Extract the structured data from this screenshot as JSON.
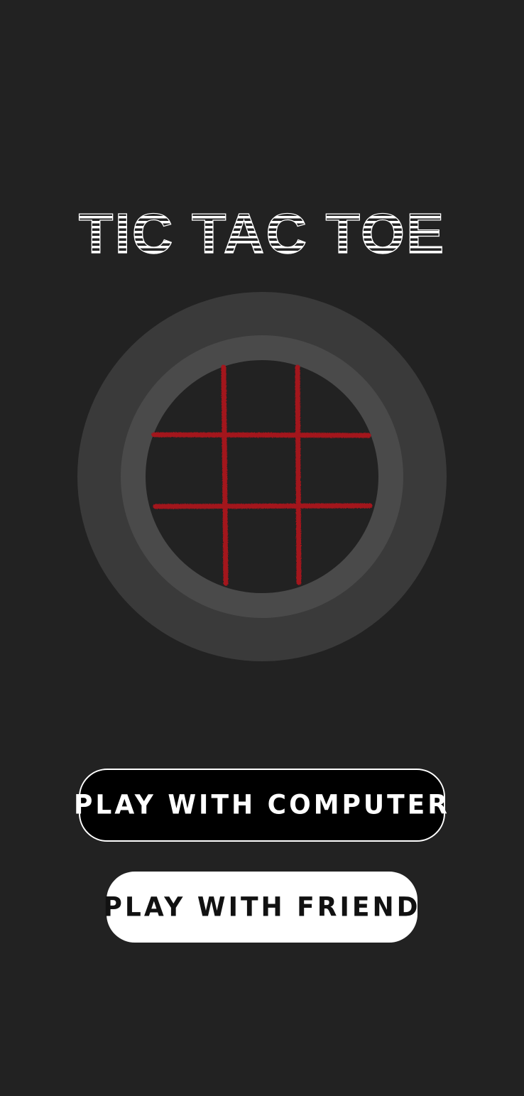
{
  "app": {
    "title": "TIC TAC TOE"
  },
  "menu": {
    "play_computer_label": "PLAY WITH COMPUTER",
    "play_friend_label": "PLAY WITH FRIEND"
  },
  "colors": {
    "background": "#222222",
    "ring_outer": "#3a3a3a",
    "ring_inner": "#4a4a4a",
    "grid_lines": "#a3121e",
    "button_dark": "#000000",
    "button_light": "#ffffff"
  },
  "icons": {
    "board": "tic-tac-toe-grid-icon"
  }
}
